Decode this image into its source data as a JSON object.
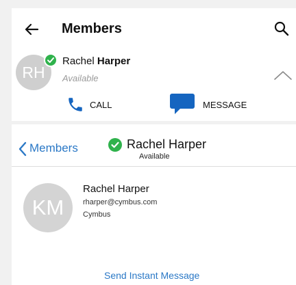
{
  "colors": {
    "accent_blue": "#2a78c6",
    "call_icon_blue": "#1565c0",
    "status_green": "#2fb24c",
    "avatar_gray": "#cfcfcf",
    "muted_text": "#9a9a9a"
  },
  "top_panel": {
    "title": "Members",
    "icons": {
      "back": "arrow-left-icon",
      "search": "search-icon",
      "collapse": "chevron-up-icon"
    },
    "contact": {
      "initials": "RH",
      "first_name": "Rachel",
      "last_name": "Harper",
      "status": "Available",
      "status_icon": "check-circle-icon"
    },
    "actions": {
      "call": {
        "icon": "phone-icon",
        "label": "CALL"
      },
      "message": {
        "icon": "chat-bubble-icon",
        "label": "MESSAGE"
      }
    }
  },
  "bottom_panel": {
    "nav": {
      "back_label": "Members",
      "back_icon": "chevron-left-icon",
      "contact_name": "Rachel Harper",
      "contact_status": "Available",
      "status_icon": "check-circle-icon"
    },
    "detail": {
      "initials": "KM",
      "name": "Rachel Harper",
      "email": "rharper@cymbus.com",
      "organization": "Cymbus"
    },
    "send_im_label": "Send Instant Message"
  }
}
